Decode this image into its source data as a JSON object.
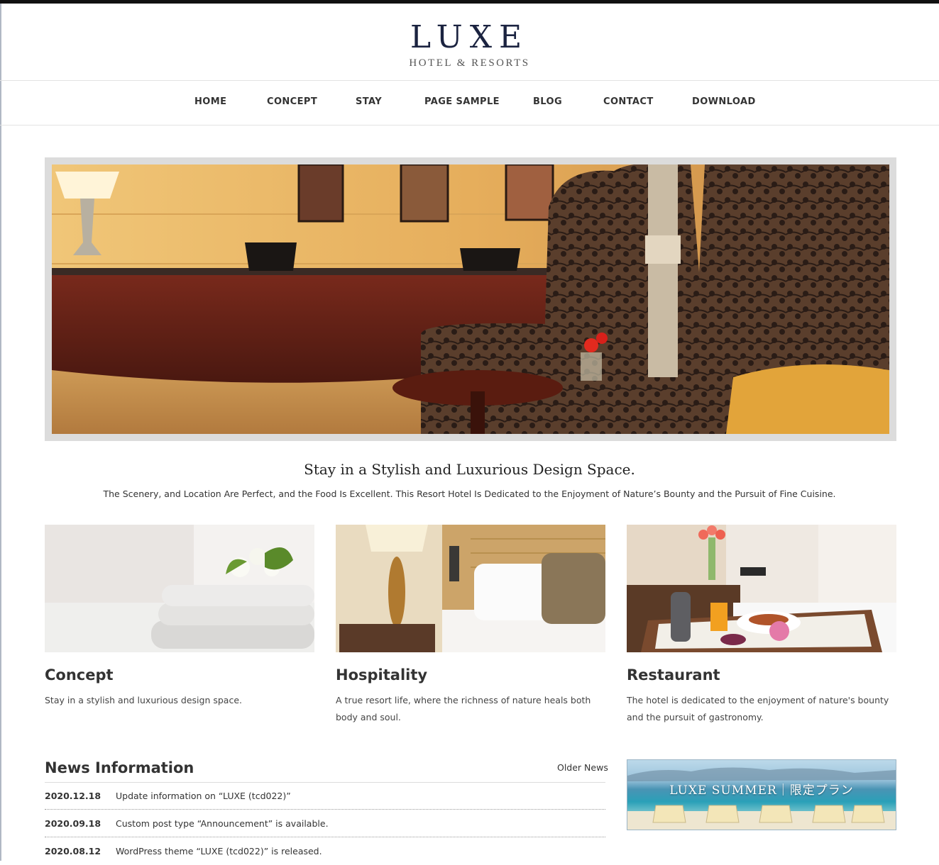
{
  "logo": {
    "main": "LUXE",
    "sub": "HOTEL & RESORTS"
  },
  "nav": [
    "HOME",
    "CONCEPT",
    "STAY",
    "PAGE SAMPLE",
    "BLOG",
    "CONTACT",
    "DOWNLOAD"
  ],
  "hero": {
    "alt": "hotel-lobby-photo"
  },
  "intro": {
    "title": "Stay in a Stylish and Luxurious Design Space.",
    "text": "The Scenery, and Location Are Perfect, and the Food Is Excellent. This Resort Hotel Is Dedicated to the Enjoyment of Nature’s Bounty and the Pursuit of Fine Cuisine."
  },
  "cards": [
    {
      "title": "Concept",
      "text": "Stay in a stylish and luxurious design space."
    },
    {
      "title": "Hospitality",
      "text": "A true resort life, where the richness of nature heals both body and soul."
    },
    {
      "title": "Restaurant",
      "text": "The hotel is dedicated to the enjoyment of nature's bounty and the pursuit of gastronomy."
    }
  ],
  "news": {
    "title": "News Information",
    "older": "Older News",
    "items": [
      {
        "date": "2020.12.18",
        "text": "Update information on “LUXE (tcd022)”"
      },
      {
        "date": "2020.09.18",
        "text": "Custom post type “Announcement” is available."
      },
      {
        "date": "2020.08.12",
        "text": "WordPress theme “LUXE (tcd022)” is released."
      }
    ]
  },
  "banner": {
    "text": "LUXE SUMMER｜限定プラン"
  }
}
